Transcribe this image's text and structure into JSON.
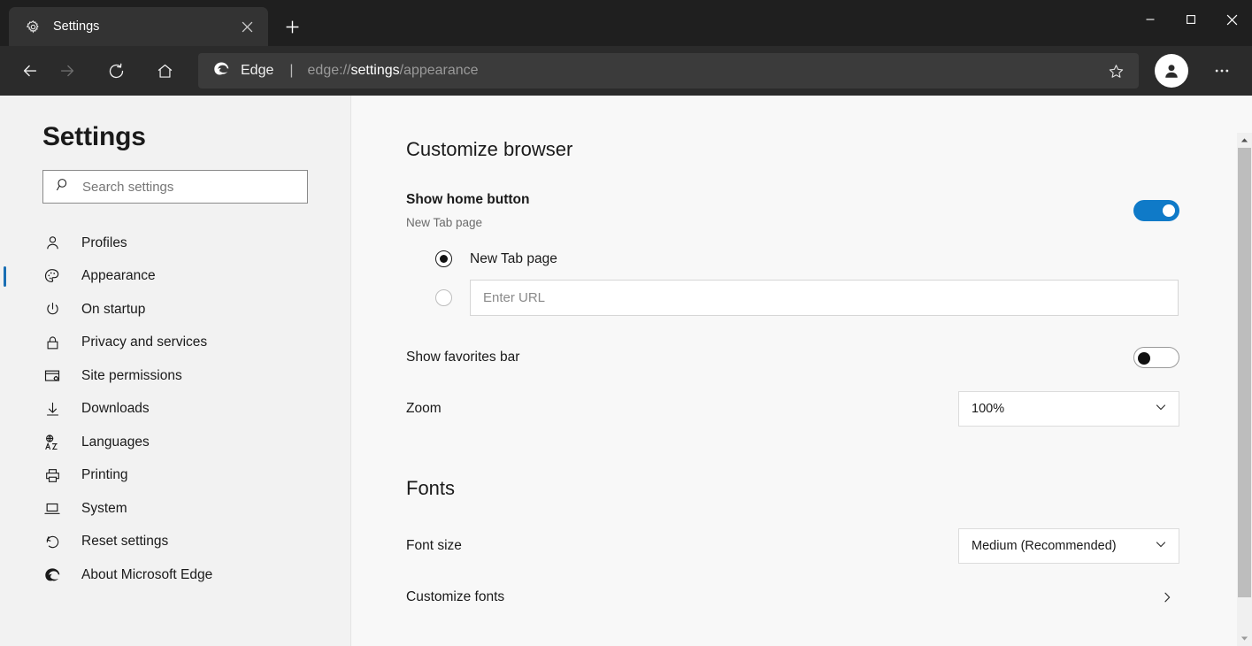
{
  "window": {
    "minimize_label": "Minimize",
    "maximize_label": "Maximize",
    "close_label": "Close"
  },
  "tabs": [
    {
      "title": "Settings",
      "favicon": "gear-icon",
      "close_label": "Close tab"
    }
  ],
  "new_tab_label": "New tab",
  "toolbar": {
    "back_label": "Back",
    "forward_label": "Forward",
    "refresh_label": "Refresh",
    "home_label": "Home",
    "brand_label": "Edge",
    "separator": "|",
    "url_prefix": "edge://",
    "url_strong": "settings",
    "url_suffix": "/appearance",
    "favorite_label": "Add to favorites",
    "profile_label": "Profile",
    "more_label": "Settings and more"
  },
  "sidebar": {
    "title": "Settings",
    "search": {
      "placeholder": "Search settings",
      "value": "",
      "icon": "search-icon"
    },
    "items": [
      {
        "label": "Profiles",
        "icon": "person-icon",
        "selected": false
      },
      {
        "label": "Appearance",
        "icon": "palette-icon",
        "selected": true
      },
      {
        "label": "On startup",
        "icon": "power-icon",
        "selected": false
      },
      {
        "label": "Privacy and services",
        "icon": "lock-icon",
        "selected": false
      },
      {
        "label": "Site permissions",
        "icon": "permissions-icon",
        "selected": false
      },
      {
        "label": "Downloads",
        "icon": "download-icon",
        "selected": false
      },
      {
        "label": "Languages",
        "icon": "translate-icon",
        "selected": false
      },
      {
        "label": "Printing",
        "icon": "printer-icon",
        "selected": false
      },
      {
        "label": "System",
        "icon": "laptop-icon",
        "selected": false
      },
      {
        "label": "Reset settings",
        "icon": "refresh-icon",
        "selected": false
      },
      {
        "label": "About Microsoft Edge",
        "icon": "edge-logo-icon",
        "selected": false
      }
    ]
  },
  "main": {
    "customize_browser": {
      "heading": "Customize browser",
      "show_home_button": {
        "label": "Show home button",
        "sublabel": "New Tab page",
        "toggle_state": "on"
      },
      "home_page_options": [
        {
          "label": "New Tab page",
          "selected": true
        },
        {
          "label": "",
          "selected": false,
          "input_placeholder": "Enter URL",
          "input_value": ""
        }
      ],
      "show_favorites_bar": {
        "label": "Show favorites bar",
        "toggle_state": "off"
      },
      "zoom": {
        "label": "Zoom",
        "value": "100%"
      }
    },
    "fonts": {
      "heading": "Fonts",
      "font_size": {
        "label": "Font size",
        "value": "Medium (Recommended)"
      },
      "customize_fonts": {
        "label": "Customize fonts",
        "chevron": "chevron-right-icon"
      }
    }
  },
  "colors": {
    "accent_blue": "#0f7ac8",
    "selection_bar": "#1a6fb4",
    "titlebar": "#1f1f1f",
    "toolbar": "#2b2b2b",
    "sidebar_bg": "#f2f2f2",
    "content_bg": "#f8f8f8"
  }
}
